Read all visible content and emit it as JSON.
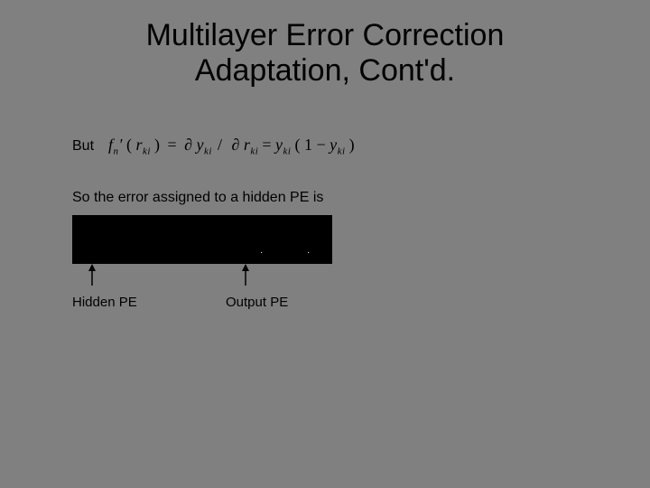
{
  "title_line1": "Multilayer Error Correction",
  "title_line2": "Adaptation, Cont'd.",
  "but_label": "But",
  "equation": {
    "lhs_f": "f",
    "lhs_n": "n",
    "lhs_prime": "′",
    "arg_r": "r",
    "sub_ki": "ki",
    "eq": "=",
    "partial": "∂",
    "y": "y",
    "slash": "/",
    "r": "r",
    "one": "1",
    "minus": "−",
    "lparen_big": "(",
    "rparen_big": ")"
  },
  "so_line": "So the error assigned to a hidden PE is",
  "label_hidden": "Hidden PE",
  "label_output": "Output PE"
}
